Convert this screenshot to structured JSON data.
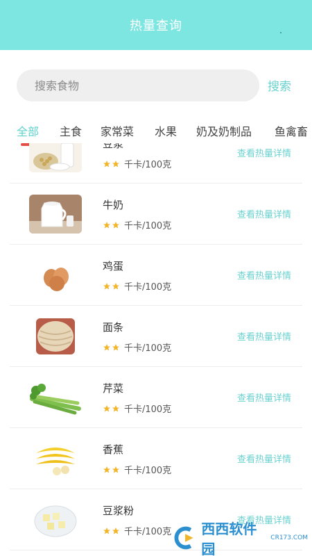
{
  "header": {
    "title": "热量查询"
  },
  "search": {
    "placeholder": "搜索食物",
    "button_label": "搜索"
  },
  "tabs": [
    {
      "label": "全部",
      "active": true
    },
    {
      "label": "主食",
      "active": false
    },
    {
      "label": "家常菜",
      "active": false
    },
    {
      "label": "水果",
      "active": false
    },
    {
      "label": "奶及奶制品",
      "active": false
    },
    {
      "label": "鱼禽畜",
      "active": false
    }
  ],
  "foods": [
    {
      "name": "豆浆",
      "stars": 2,
      "unit": "千卡/100克",
      "link": "查看热量详情"
    },
    {
      "name": "牛奶",
      "stars": 2,
      "unit": "千卡/100克",
      "link": "查看热量详情"
    },
    {
      "name": "鸡蛋",
      "stars": 2,
      "unit": "千卡/100克",
      "link": "查看热量详情"
    },
    {
      "name": "面条",
      "stars": 2,
      "unit": "千卡/100克",
      "link": "查看热量详情"
    },
    {
      "name": "芹菜",
      "stars": 2,
      "unit": "千卡/100克",
      "link": "查看热量详情"
    },
    {
      "name": "香蕉",
      "stars": 2,
      "unit": "千卡/100克",
      "link": "查看热量详情"
    },
    {
      "name": "豆浆粉",
      "stars": 2,
      "unit": "千卡/100克",
      "link": "查看热量详情"
    }
  ],
  "watermark": {
    "text": "西西软件园",
    "sub": "CR173.COM"
  },
  "colors": {
    "header_bg": "#7ee6e0",
    "accent": "#6ad2cf",
    "indicator": "#e34f44",
    "star": "#f0b52a"
  }
}
